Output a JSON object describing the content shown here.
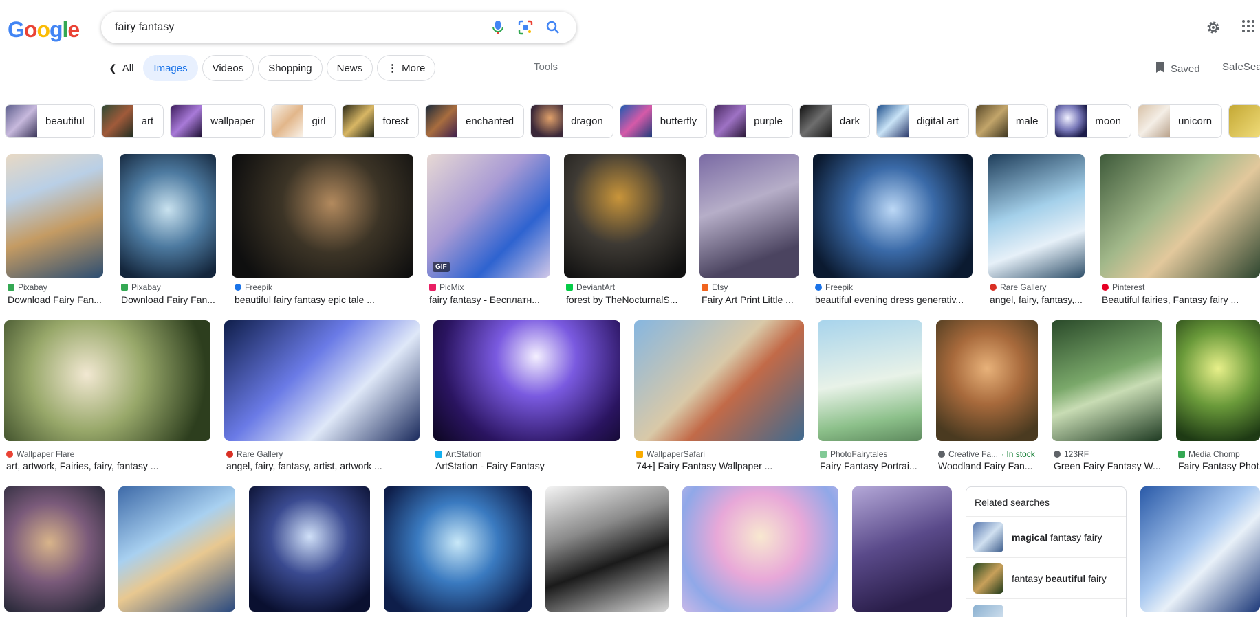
{
  "logo": {
    "text": "Google"
  },
  "search": {
    "value": "fairy fantasy"
  },
  "icons": {
    "mic": "mic-icon",
    "lens": "lens-icon",
    "search": "search-icon",
    "settings": "gear-icon",
    "apps": "apps-grid-icon"
  },
  "tabs": [
    {
      "label": "All"
    },
    {
      "label": "Images",
      "active": true
    },
    {
      "label": "Videos"
    },
    {
      "label": "Shopping"
    },
    {
      "label": "News"
    },
    {
      "label": "More"
    }
  ],
  "tools_label": "Tools",
  "saved_label": "Saved",
  "safesearch_label": "SafeSearch",
  "chips": [
    "beautiful",
    "art",
    "wallpaper",
    "girl",
    "forest",
    "enchanted",
    "dragon",
    "butterfly",
    "purple",
    "dark",
    "digital art",
    "male",
    "moon",
    "unicorn"
  ],
  "results": [
    {
      "source": "Pixabay",
      "title": "Download Fairy Fan...",
      "color": "#34a853"
    },
    {
      "source": "Pixabay",
      "title": "Download Fairy Fan...",
      "color": "#34a853"
    },
    {
      "source": "Freepik",
      "title": "beautiful fairy fantasy epic tale ...",
      "color": "#1a73e8"
    },
    {
      "source": "PicMix",
      "title": "fairy fantasy - Бесплатн...",
      "color": "#e91e63",
      "badge": "GIF"
    },
    {
      "source": "DeviantArt",
      "title": "forest by TheNocturnalS...",
      "color": "#05cc47"
    },
    {
      "source": "Etsy",
      "title": "Fairy Art Print Little ...",
      "color": "#f1641e"
    },
    {
      "source": "Freepik",
      "title": "beautiful evening dress generativ...",
      "color": "#1a73e8"
    },
    {
      "source": "Rare Gallery",
      "title": "angel, fairy, fantasy,...",
      "color": "#d93025"
    },
    {
      "source": "Pinterest",
      "title": "Beautiful fairies, Fantasy fairy ...",
      "color": "#e60023"
    },
    {
      "source": "Wallpaper Flare",
      "title": "art, artwork, Fairies, fairy, fantasy ...",
      "color": "#ea4335"
    },
    {
      "source": "Rare Gallery",
      "title": "angel, fairy, fantasy, artist, artwork ...",
      "color": "#d93025"
    },
    {
      "source": "ArtStation",
      "title": "ArtStation - Fairy Fantasy",
      "color": "#13aff0"
    },
    {
      "source": "WallpaperSafari",
      "title": "74+] Fairy Fantasy Wallpaper ...",
      "color": "#f9ab00"
    },
    {
      "source": "PhotoFairytales",
      "title": "Fairy Fantasy Portrai...",
      "color": "#81c995"
    },
    {
      "source": "Creative Fa...",
      "instock": "· In stock",
      "title": "Woodland Fairy Fan...",
      "color": "#5f6368"
    },
    {
      "source": "123RF",
      "title": "Green Fairy Fantasy W...",
      "color": "#5f6368"
    },
    {
      "source": "Media Chomp",
      "title": "Fairy Fantasy Phot...",
      "color": "#34a853"
    }
  ],
  "related": {
    "heading": "Related searches",
    "items": [
      {
        "bold": "magical",
        "rest": " fantasy fairy",
        "pre": ""
      },
      {
        "pre": "fantasy ",
        "bold": "beautiful",
        "rest": " fairy"
      }
    ]
  }
}
